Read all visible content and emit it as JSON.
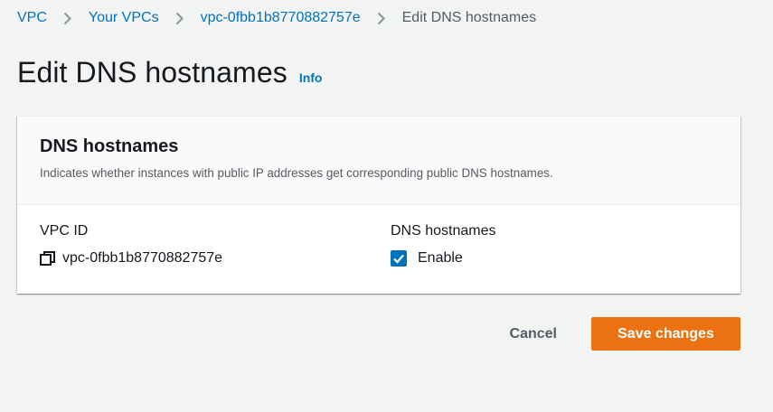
{
  "breadcrumb": {
    "items": [
      "VPC",
      "Your VPCs",
      "vpc-0fbb1b8770882757e"
    ],
    "current": "Edit DNS hostnames"
  },
  "header": {
    "title": "Edit DNS hostnames",
    "info_label": "Info"
  },
  "container": {
    "title": "DNS hostnames",
    "description": "Indicates whether instances with public IP addresses get corresponding public DNS hostnames.",
    "vpc_id": {
      "label": "VPC ID",
      "value": "vpc-0fbb1b8770882757e",
      "icon": "copy-icon"
    },
    "dns_hostnames": {
      "label": "DNS hostnames",
      "checkbox_label": "Enable",
      "checked": true
    }
  },
  "actions": {
    "cancel_label": "Cancel",
    "save_label": "Save changes"
  },
  "colors": {
    "link": "#0073bb",
    "primary": "#ec7211",
    "background": "#f2f3f3"
  }
}
